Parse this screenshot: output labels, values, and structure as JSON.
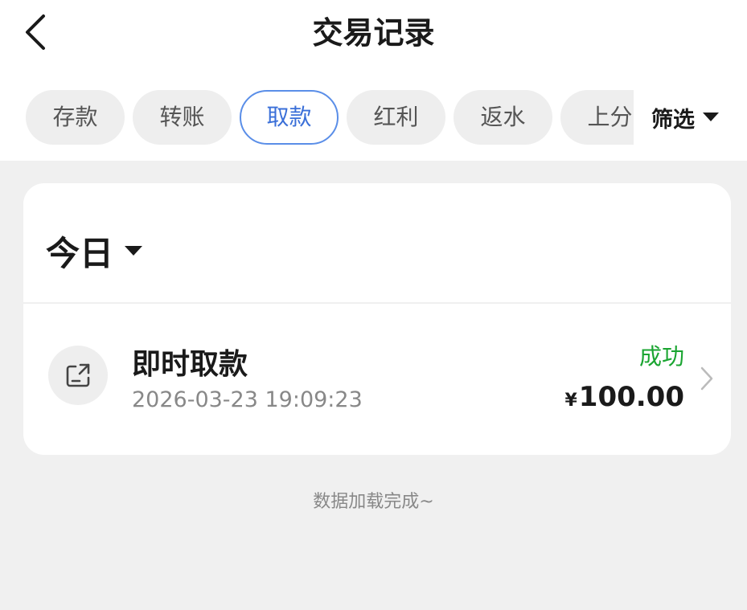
{
  "header": {
    "title": "交易记录",
    "back_icon": "chevron-left-icon"
  },
  "tabs": [
    {
      "label": "存款",
      "active": false
    },
    {
      "label": "转账",
      "active": false
    },
    {
      "label": "取款",
      "active": true
    },
    {
      "label": "红利",
      "active": false
    },
    {
      "label": "返水",
      "active": false
    },
    {
      "label": "上分",
      "active": false
    }
  ],
  "filter": {
    "label": "筛选",
    "icon": "caret-down-icon"
  },
  "date_selector": {
    "label": "今日",
    "icon": "caret-down-icon"
  },
  "records": [
    {
      "title": "即时取款",
      "time": "2026-03-23 19:09:23",
      "status": "成功",
      "currency": "¥",
      "amount": "100.00",
      "icon": "withdraw-icon"
    }
  ],
  "footer": {
    "note": "数据加载完成~"
  },
  "colors": {
    "accent": "#3a6fd8",
    "success": "#1aa531",
    "background": "#f0f0f0"
  }
}
